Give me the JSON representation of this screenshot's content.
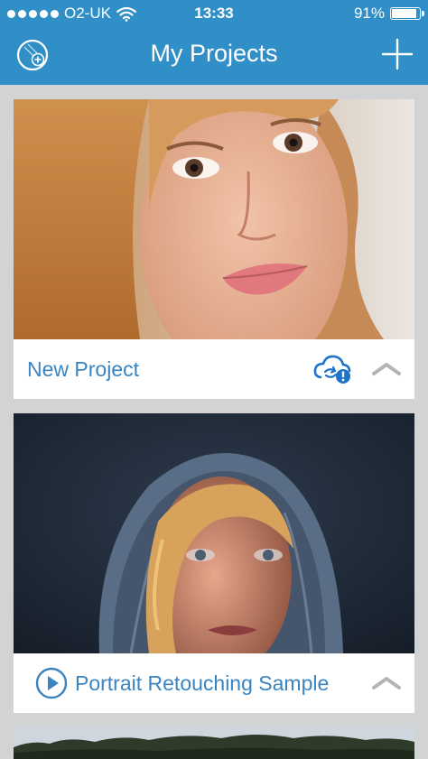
{
  "status_bar": {
    "carrier": "O2-UK",
    "time": "13:33",
    "battery_percent": "91%",
    "battery_level": 0.91
  },
  "nav": {
    "title": "My Projects",
    "left_icon": "app-logo-icon",
    "right_icon": "plus-icon"
  },
  "projects": [
    {
      "title": "New Project",
      "status_icon": "cloud-sync-alert-icon",
      "toggle_icon": "chevron-up-icon"
    },
    {
      "title": "Portrait Retouching Sample",
      "lead_icon": "play-icon",
      "toggle_icon": "chevron-up-icon"
    }
  ],
  "colors": {
    "header_blue": "#2f8fc6",
    "accent_blue": "#3a84c1",
    "alert_blue": "#1e73c8",
    "chevron_gray": "#b5b5b5",
    "page_bg": "#d2d3d4"
  }
}
